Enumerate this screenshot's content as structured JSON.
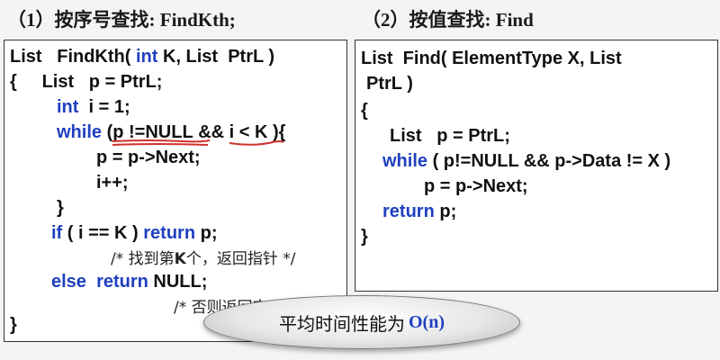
{
  "headings": {
    "left": "（1）按序号查找: FindKth;",
    "right": "（2）按值查找: Find"
  },
  "findkth": {
    "l1a": "List   FindKth( ",
    "l1kw": "int",
    "l1b": " K, List  PtrL )",
    "l2": "{     List   p = PtrL;",
    "l3kw": "int",
    "l3b": "  i = 1;",
    "l4kw": "while",
    "l4a": " (",
    "l4u1": "p !=NULL",
    "l4b": " && ",
    "l4u2": "i < K",
    "l4c": " ){",
    "l5": "p = p->Next;",
    "l6": "i++;",
    "l7": "}",
    "l8kw1": "if",
    "l8a": " ( i == K ) ",
    "l8kw2": "return",
    "l8b": " p;",
    "l9a": "/* 找到第",
    "l9k": "K",
    "l9b": "个，返回指针 */",
    "l10kw1": "else",
    "l10a": "  ",
    "l10kw2": "return",
    "l10b": " NULL;",
    "l11": "/* 否则返回空",
    "l12": "}"
  },
  "find": {
    "l1": "List  Find( ElementType X, List",
    "l2": "PtrL )",
    "l3": "{",
    "l4": "List   p = PtrL;",
    "l5kw": "while",
    "l5b": " ( p!=NULL && p->Data != X )",
    "l6": "p = p->Next;",
    "l7kw": "return",
    "l7b": " p;",
    "l8": "}"
  },
  "callout": {
    "text": "平均时间性能为",
    "complexity": "O(n)"
  },
  "colors": {
    "keyword": "#1f3fbf",
    "underline": "#d0312d"
  }
}
